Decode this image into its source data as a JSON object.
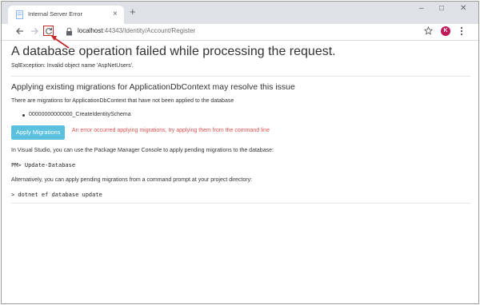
{
  "browser": {
    "tab_title": "Internal Server Error",
    "tab_close_glyph": "×",
    "new_tab_glyph": "+",
    "window_controls": [
      "–",
      "□",
      "✕"
    ],
    "url_host": "localhost",
    "url_rest": ":44343/Identity/Account/Register",
    "profile_initial": "K",
    "colors": {
      "tabstrip": "#dee1e6",
      "avatar": "#c2185b",
      "highlight": "#c62828"
    }
  },
  "page": {
    "title": "A database operation failed while processing the request.",
    "exception": "SqlException: Invalid object name 'AspNetUsers'.",
    "migrations_heading": "Applying existing migrations for ApplicationDbContext may resolve this issue",
    "pending_intro": "There are migrations for ApplicationDbContext that have not been applied to the database",
    "migrations": [
      "00000000000000_CreateIdentitySchema"
    ],
    "apply_button": "Apply Migrations",
    "apply_error": "An error occurred applying migrations, try applying them from the command line",
    "vs_instructions": "In Visual Studio, you can use the Package Manager Console to apply pending migrations to the database:",
    "pm_command": "PM> Update-Database",
    "cli_instructions": "Alternatively, you can apply pending migrations from a command prompt at your project directory:",
    "cli_command": "> dotnet ef database update",
    "colors": {
      "button": "#5bc0de",
      "error_text": "#d9534f"
    }
  }
}
